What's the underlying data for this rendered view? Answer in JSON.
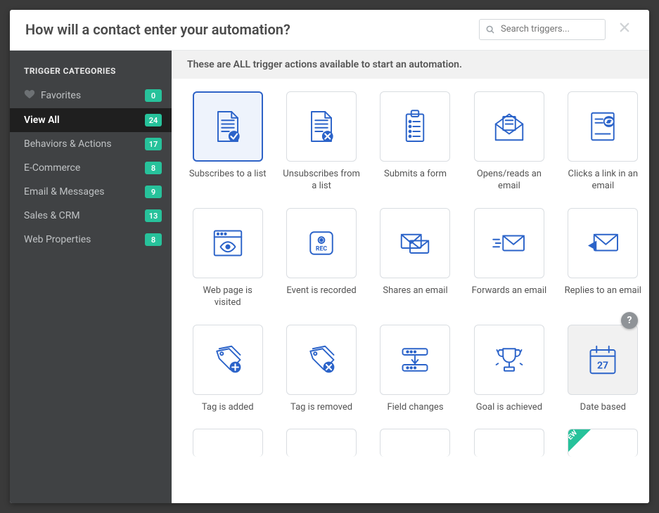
{
  "title": "How will a contact enter your automation?",
  "search": {
    "placeholder": "Search triggers...",
    "value": ""
  },
  "sidebar": {
    "heading": "TRIGGER CATEGORIES",
    "items": [
      {
        "label": "Favorites",
        "count": "0",
        "icon": "heart",
        "active": false
      },
      {
        "label": "View All",
        "count": "24",
        "icon": null,
        "active": true
      },
      {
        "label": "Behaviors & Actions",
        "count": "17",
        "icon": null,
        "active": false
      },
      {
        "label": "E-Commerce",
        "count": "8",
        "icon": null,
        "active": false
      },
      {
        "label": "Email & Messages",
        "count": "9",
        "icon": null,
        "active": false
      },
      {
        "label": "Sales & CRM",
        "count": "13",
        "icon": null,
        "active": false
      },
      {
        "label": "Web Properties",
        "count": "8",
        "icon": null,
        "active": false
      }
    ]
  },
  "strip_text": "These are ALL trigger actions available to start an automation.",
  "triggers": [
    {
      "label": "Subscribes to a list",
      "icon": "doc-check",
      "selected": true
    },
    {
      "label": "Unsubscribes from a list",
      "icon": "doc-x",
      "selected": false
    },
    {
      "label": "Submits a form",
      "icon": "clipboard",
      "selected": false
    },
    {
      "label": "Opens/reads an email",
      "icon": "envelope-open",
      "selected": false
    },
    {
      "label": "Clicks a link in an email",
      "icon": "doc-link",
      "selected": false
    },
    {
      "label": "Web page is visited",
      "icon": "browser-eye",
      "selected": false
    },
    {
      "label": "Event is recorded",
      "icon": "rec",
      "selected": false
    },
    {
      "label": "Shares an email",
      "icon": "mail-pair",
      "selected": false
    },
    {
      "label": "Forwards an email",
      "icon": "mail-forward",
      "selected": false
    },
    {
      "label": "Replies to an email",
      "icon": "mail-reply",
      "selected": false
    },
    {
      "label": "Tag is added",
      "icon": "tag-plus",
      "selected": false
    },
    {
      "label": "Tag is removed",
      "icon": "tag-x",
      "selected": false
    },
    {
      "label": "Field changes",
      "icon": "fields",
      "selected": false
    },
    {
      "label": "Goal is achieved",
      "icon": "trophy",
      "selected": false
    },
    {
      "label": "Date based",
      "icon": "calendar",
      "selected": false,
      "highlight": true
    }
  ],
  "ribbon_label": "EW",
  "help_label": "?"
}
